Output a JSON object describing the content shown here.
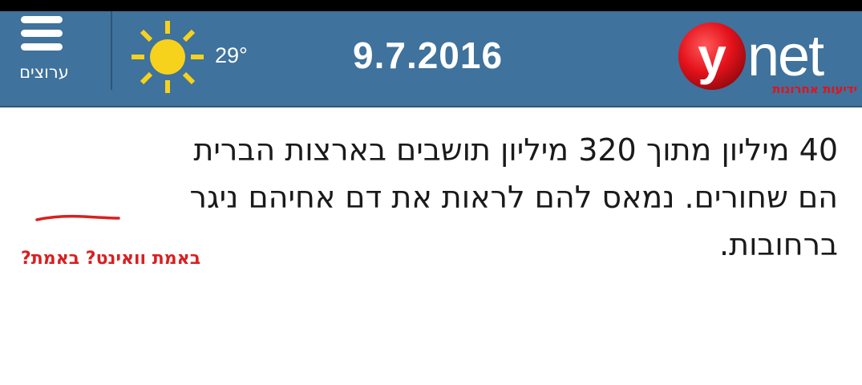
{
  "colors": {
    "header_bg": "#3f729c",
    "logo_red": "#e4121b",
    "sun_yellow": "#f7d21c",
    "annotation_red": "#d82020"
  },
  "header": {
    "menu_label": "ערוצים",
    "menu_icon": "hamburger-icon",
    "weather_icon": "sun-icon",
    "temperature": "29°",
    "date": "9.7.2016",
    "logo": {
      "y_letter": "y",
      "net_text": "net",
      "subtitle": "ידיעות אחרונות"
    }
  },
  "article": {
    "line1": "40 מיליון מתוך 320 מיליון תושבים בארצות הברית",
    "line2_before": "הם שחורים. נמאס להם לראות את דם אחיהם ",
    "line2_underlined": "ניגר",
    "line3": "ברחובות."
  },
  "annotation": {
    "text": "באמת וואינט? באמת?"
  }
}
